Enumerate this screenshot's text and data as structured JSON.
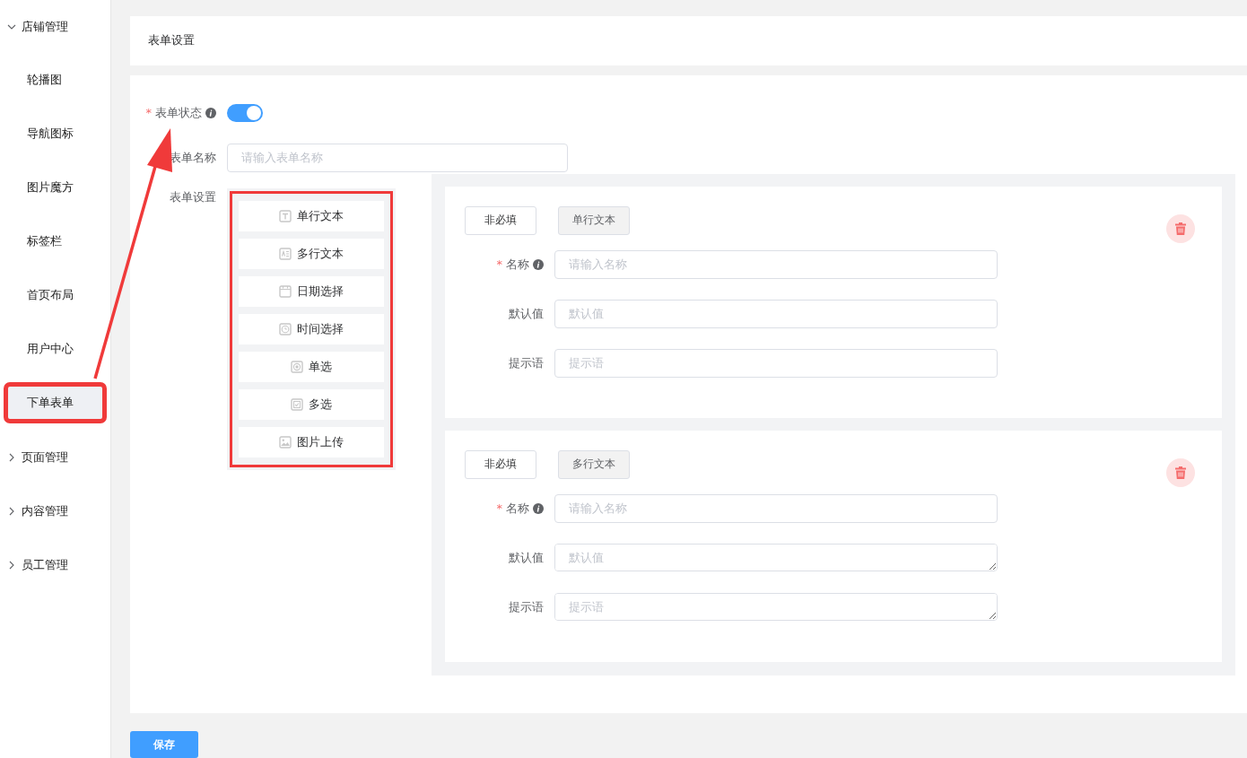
{
  "sidebar": {
    "groups": [
      {
        "label": "店铺管理",
        "expanded": true,
        "children": [
          {
            "label": "轮播图",
            "selected": false,
            "highlighted": false
          },
          {
            "label": "导航图标",
            "selected": false,
            "highlighted": false
          },
          {
            "label": "图片魔方",
            "selected": false,
            "highlighted": false
          },
          {
            "label": "标签栏",
            "selected": false,
            "highlighted": false
          },
          {
            "label": "首页布局",
            "selected": false,
            "highlighted": false
          },
          {
            "label": "用户中心",
            "selected": false,
            "highlighted": false
          },
          {
            "label": "下单表单",
            "selected": true,
            "highlighted": true
          }
        ]
      },
      {
        "label": "页面管理",
        "expanded": false
      },
      {
        "label": "内容管理",
        "expanded": false
      },
      {
        "label": "员工管理",
        "expanded": false
      }
    ]
  },
  "header": {
    "title": "表单设置"
  },
  "form": {
    "status": {
      "label": "表单状态",
      "required_mark": "*",
      "info": true,
      "on": true
    },
    "name": {
      "label": "表单名称",
      "placeholder": "请输入表单名称"
    },
    "settings": {
      "label": "表单设置",
      "highlighted": true,
      "field_types": [
        {
          "label": "单行文本",
          "kind": "text"
        },
        {
          "label": "多行文本",
          "kind": "textarea"
        },
        {
          "label": "日期选择",
          "kind": "date"
        },
        {
          "label": "时间选择",
          "kind": "time"
        },
        {
          "label": "单选",
          "kind": "radio"
        },
        {
          "label": "多选",
          "kind": "checkbox"
        },
        {
          "label": "图片上传",
          "kind": "image"
        }
      ],
      "fields": [
        {
          "required_button": "非必填",
          "type_tag": "单行文本",
          "rows": [
            {
              "label": "名称",
              "required_mark": "*",
              "info": true,
              "placeholder": "请输入名称",
              "kind": "input"
            },
            {
              "label": "默认值",
              "info": false,
              "placeholder": "默认值",
              "kind": "input"
            },
            {
              "label": "提示语",
              "info": false,
              "placeholder": "提示语",
              "kind": "input"
            }
          ]
        },
        {
          "required_button": "非必填",
          "type_tag": "多行文本",
          "rows": [
            {
              "label": "名称",
              "required_mark": "*",
              "info": true,
              "placeholder": "请输入名称",
              "kind": "input"
            },
            {
              "label": "默认值",
              "info": false,
              "placeholder": "默认值",
              "kind": "textarea"
            },
            {
              "label": "提示语",
              "info": false,
              "placeholder": "提示语",
              "kind": "textarea"
            }
          ]
        }
      ]
    }
  },
  "save_button": "保存",
  "annotation_arrow": true
}
